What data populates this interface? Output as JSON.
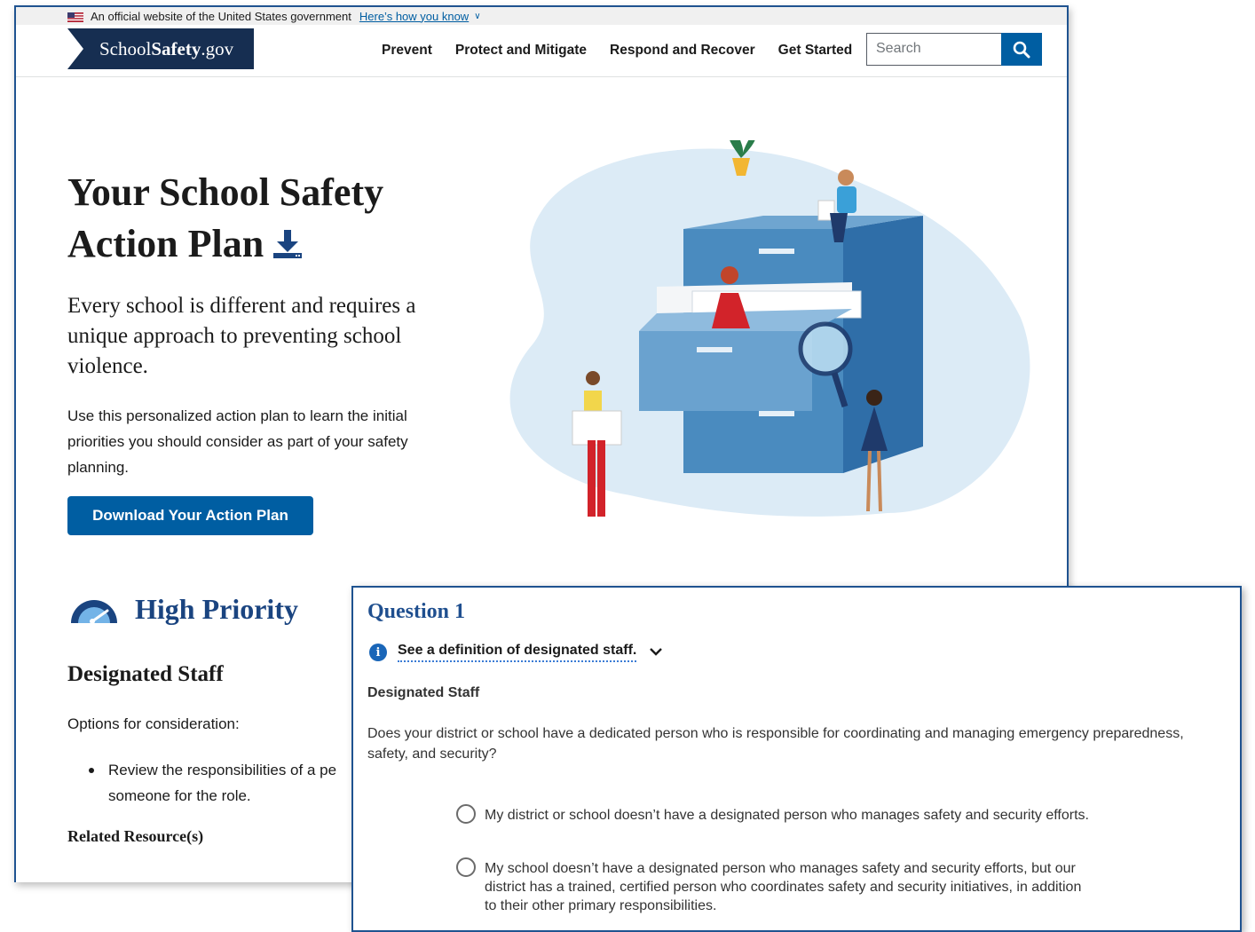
{
  "gov_banner": {
    "text": "An official website of the United States government",
    "link": "Here’s how you know"
  },
  "header": {
    "logo_prefix": "School",
    "logo_bold": "Safety",
    "logo_suffix": ".gov",
    "nav": [
      "Prevent",
      "Protect and Mitigate",
      "Respond and Recover",
      "Get Started"
    ],
    "search_placeholder": "Search"
  },
  "hero": {
    "title_line1": "Your School Safety",
    "title_line2": "Action Plan",
    "lede": "Every school is different and requires a unique approach to preventing school violence.",
    "body": "Use this personalized action plan to learn the initial priorities you should consider as part of your safety planning.",
    "download_label": "Download Your Action Plan"
  },
  "priority_section": {
    "heading": "High Priority",
    "subheading": "Designated Staff",
    "options_label": "Options for consideration:",
    "bullet": "Review the responsibilities of a pe someone for the role.",
    "related_label": "Related Resource(s)"
  },
  "question_panel": {
    "title": "Question 1",
    "definition_toggle": "See a definition of designated staff.",
    "section_label": "Designated Staff",
    "question": "Does your district or school have a dedicated person who is responsible for coordinating and managing emergency preparedness, safety, and security?",
    "options": [
      "My district or school doesn’t have a designated person who manages safety and security efforts.",
      "My school doesn’t have a designated person who manages safety and security efforts, but our district has a trained, certified person who coordinates safety and security initiatives, in addition to their other primary responsibilities."
    ]
  },
  "colors": {
    "primary_blue": "#005ea2",
    "navy": "#162e51",
    "heading_blue": "#1a4480",
    "window_border": "#1f5390"
  }
}
